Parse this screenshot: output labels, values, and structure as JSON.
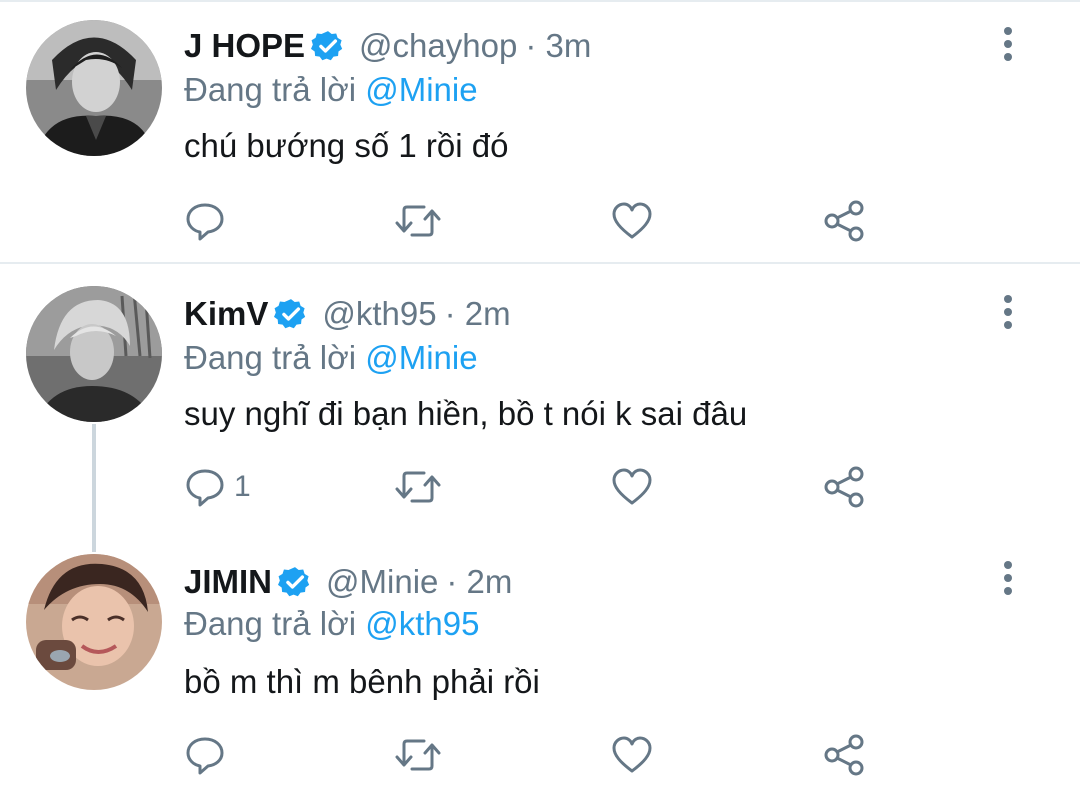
{
  "tweets": [
    {
      "display_name": "J HOPE",
      "handle": "@chayhop",
      "time": "· 3m",
      "replying_label": "Đang trả lời",
      "replying_to": "@Minie",
      "text": "chú bướng số 1 rồi đó",
      "reply_count": "",
      "verified": true,
      "avatar": "avatar-jhope"
    },
    {
      "display_name": "KimV",
      "handle": "@kth95",
      "time": "· 2m",
      "replying_label": "Đang trả lời",
      "replying_to": "@Minie",
      "text": "suy nghĩ đi bạn hiền, bồ t nói k sai đâu",
      "reply_count": "1",
      "verified": true,
      "avatar": "avatar-kimv"
    },
    {
      "display_name": "JIMIN",
      "handle": "@Minie",
      "time": "· 2m",
      "replying_label": "Đang trả lời",
      "replying_to": "@kth95",
      "text": "bồ m thì m bênh phải rồi",
      "reply_count": "",
      "verified": true,
      "avatar": "avatar-jimin"
    }
  ],
  "colors": {
    "accent": "#1da1f2",
    "text": "#14171a",
    "secondary": "#657786",
    "divider": "#e6ecf0",
    "icon": "#657786"
  },
  "icons": {
    "reply": "reply-icon",
    "retweet": "retweet-icon",
    "like": "like-icon",
    "share": "share-icon",
    "more": "more-icon",
    "verified": "verified-badge-icon"
  }
}
